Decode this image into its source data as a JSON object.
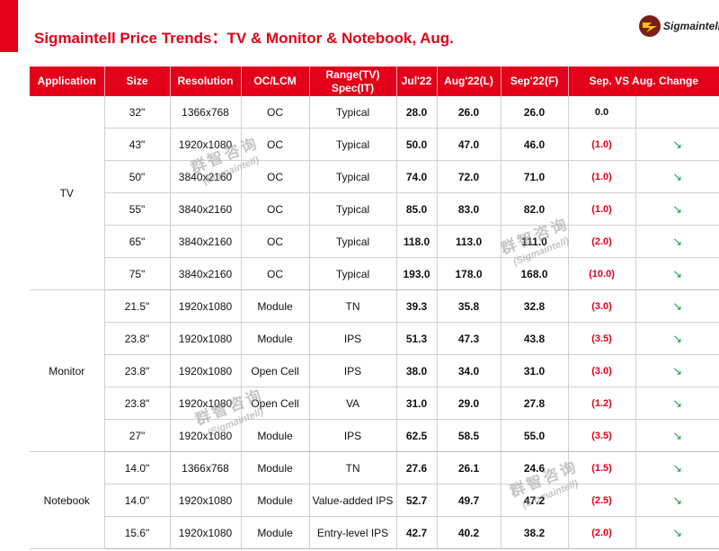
{
  "header": {
    "title": "Sigmaintell Price Trends：TV & Monitor & Notebook, Aug.",
    "logo_text": "Sigmaintell",
    "accent_color": "#e2001a"
  },
  "table": {
    "headers": {
      "application": "Application",
      "size": "Size",
      "resolution": "Resolution",
      "oc_lcm": "OC/LCM",
      "range_line1": "Range(TV)",
      "range_line2": "Spec(IT)",
      "jul": "Jul'22",
      "aug": "Aug'22(L)",
      "sep": "Sep'22(F)",
      "change": "Sep. VS Aug. Change"
    },
    "groups": [
      {
        "application": "TV",
        "rows": [
          {
            "size": "32\"",
            "resolution": "1366x768",
            "oc_lcm": "OC",
            "spec": "Typical",
            "jul": "28.0",
            "aug": "26.0",
            "sep": "26.0",
            "change": "0.0",
            "trend": ""
          },
          {
            "size": "43\"",
            "resolution": "1920x1080",
            "oc_lcm": "OC",
            "spec": "Typical",
            "jul": "50.0",
            "aug": "47.0",
            "sep": "46.0",
            "change": "(1.0)",
            "trend": "↘"
          },
          {
            "size": "50\"",
            "resolution": "3840x2160",
            "oc_lcm": "OC",
            "spec": "Typical",
            "jul": "74.0",
            "aug": "72.0",
            "sep": "71.0",
            "change": "(1.0)",
            "trend": "↘"
          },
          {
            "size": "55\"",
            "resolution": "3840x2160",
            "oc_lcm": "OC",
            "spec": "Typical",
            "jul": "85.0",
            "aug": "83.0",
            "sep": "82.0",
            "change": "(1.0)",
            "trend": "↘"
          },
          {
            "size": "65\"",
            "resolution": "3840x2160",
            "oc_lcm": "OC",
            "spec": "Typical",
            "jul": "118.0",
            "aug": "113.0",
            "sep": "111.0",
            "change": "(2.0)",
            "trend": "↘"
          },
          {
            "size": "75\"",
            "resolution": "3840x2160",
            "oc_lcm": "OC",
            "spec": "Typical",
            "jul": "193.0",
            "aug": "178.0",
            "sep": "168.0",
            "change": "(10.0)",
            "trend": "↘"
          }
        ]
      },
      {
        "application": "Monitor",
        "rows": [
          {
            "size": "21.5\"",
            "resolution": "1920x1080",
            "oc_lcm": "Module",
            "spec": "TN",
            "jul": "39.3",
            "aug": "35.8",
            "sep": "32.8",
            "change": "(3.0)",
            "trend": "↘"
          },
          {
            "size": "23.8\"",
            "resolution": "1920x1080",
            "oc_lcm": "Module",
            "spec": "IPS",
            "jul": "51.3",
            "aug": "47.3",
            "sep": "43.8",
            "change": "(3.5)",
            "trend": "↘"
          },
          {
            "size": "23.8\"",
            "resolution": "1920x1080",
            "oc_lcm": "Open Cell",
            "spec": "IPS",
            "jul": "38.0",
            "aug": "34.0",
            "sep": "31.0",
            "change": "(3.0)",
            "trend": "↘"
          },
          {
            "size": "23.8\"",
            "resolution": "1920x1080",
            "oc_lcm": "Open Cell",
            "spec": "VA",
            "jul": "31.0",
            "aug": "29.0",
            "sep": "27.8",
            "change": "(1.2)",
            "trend": "↘"
          },
          {
            "size": "27\"",
            "resolution": "1920x1080",
            "oc_lcm": "Module",
            "spec": "IPS",
            "jul": "62.5",
            "aug": "58.5",
            "sep": "55.0",
            "change": "(3.5)",
            "trend": "↘"
          }
        ]
      },
      {
        "application": "Notebook",
        "rows": [
          {
            "size": "14.0\"",
            "resolution": "1366x768",
            "oc_lcm": "Module",
            "spec": "TN",
            "jul": "27.6",
            "aug": "26.1",
            "sep": "24.6",
            "change": "(1.5)",
            "trend": "↘"
          },
          {
            "size": "14.0\"",
            "resolution": "1920x1080",
            "oc_lcm": "Module",
            "spec": "Value-added IPS",
            "jul": "52.7",
            "aug": "49.7",
            "sep": "47.2",
            "change": "(2.5)",
            "trend": "↘"
          },
          {
            "size": "15.6\"",
            "resolution": "1920x1080",
            "oc_lcm": "Module",
            "spec": "Entry-level IPS",
            "jul": "42.7",
            "aug": "40.2",
            "sep": "38.2",
            "change": "(2.0)",
            "trend": "↘"
          }
        ]
      }
    ]
  },
  "watermark": {
    "cn": "群智咨询",
    "en": "(Sigmaintell)"
  }
}
